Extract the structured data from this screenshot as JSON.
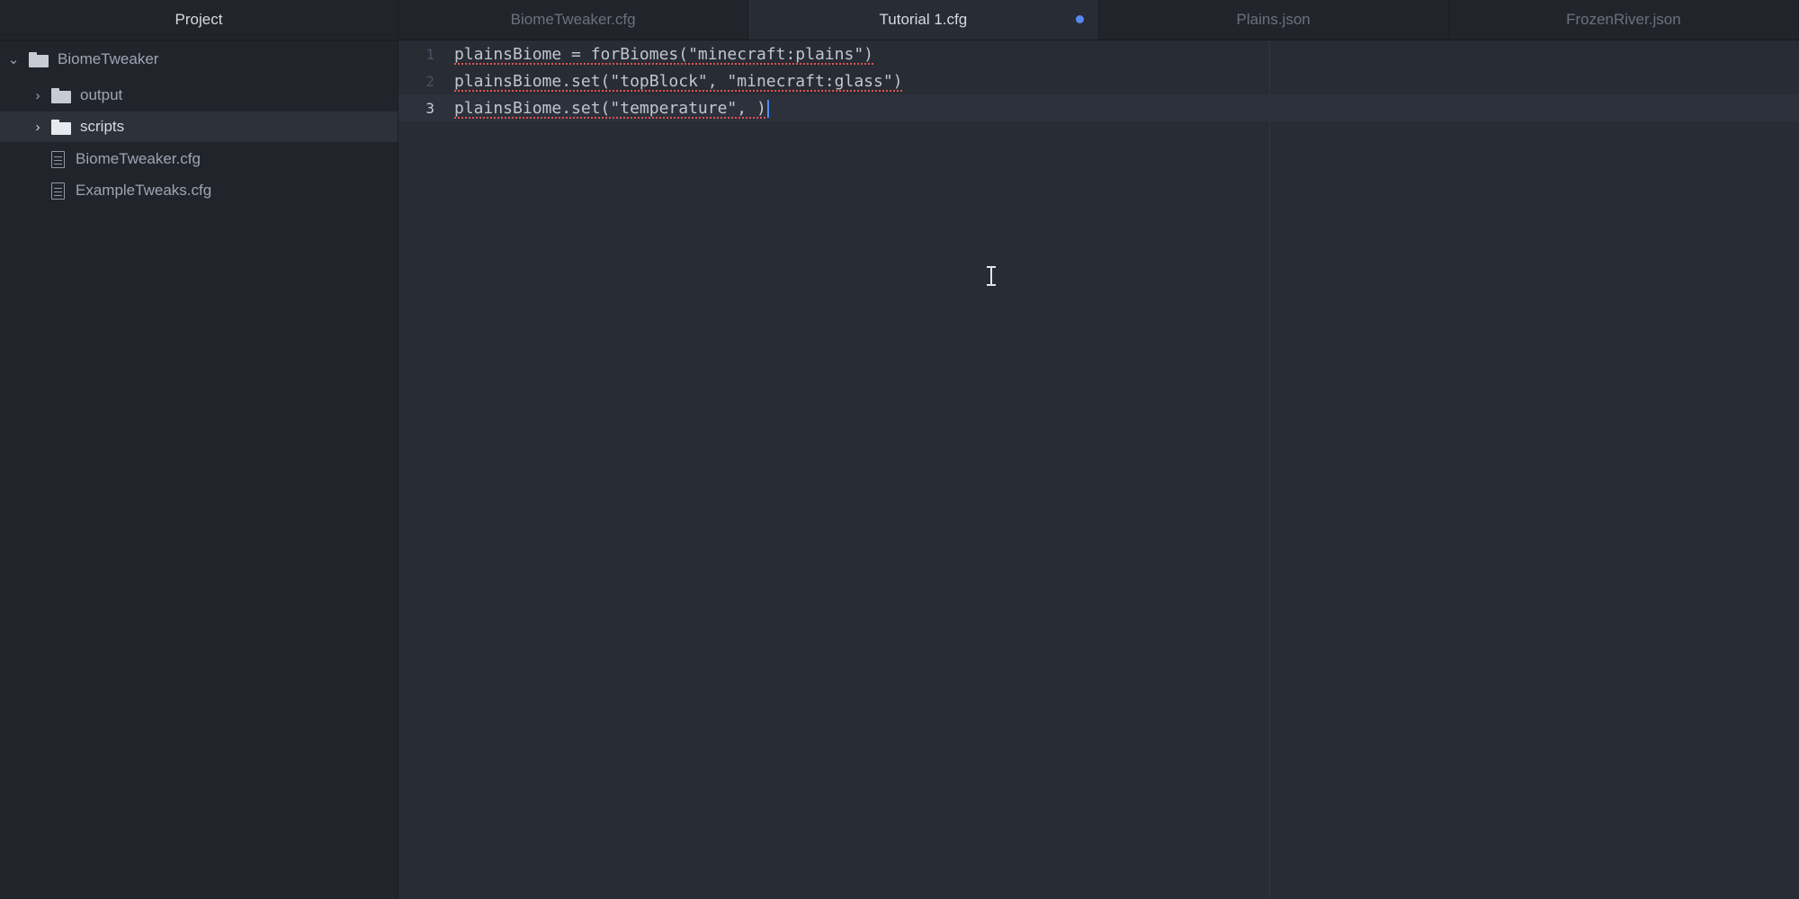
{
  "sidebar": {
    "header": "Project",
    "root": {
      "label": "BiomeTweaker",
      "expanded": true,
      "icon": "folder-icon"
    },
    "items": [
      {
        "label": "output",
        "type": "folder",
        "icon": "folder-icon",
        "expanded": false
      },
      {
        "label": "scripts",
        "type": "folder",
        "icon": "folder-icon",
        "expanded": false,
        "selected": true
      },
      {
        "label": "BiomeTweaker.cfg",
        "type": "file",
        "icon": "file-text-icon"
      },
      {
        "label": "ExampleTweaks.cfg",
        "type": "file",
        "icon": "file-text-icon"
      }
    ]
  },
  "tabs": [
    {
      "label": "BiomeTweaker.cfg",
      "active": false
    },
    {
      "label": "Tutorial 1.cfg",
      "active": true,
      "modified": true
    },
    {
      "label": "Plains.json",
      "active": false
    },
    {
      "label": "FrozenRiver.json",
      "active": false
    }
  ],
  "editor": {
    "current_line": 3,
    "lines": [
      {
        "number": "1",
        "text": "plainsBiome = forBiomes(\"minecraft:plains\")"
      },
      {
        "number": "2",
        "text": "plainsBiome.set(\"topBlock\", \"minecraft:glass\")"
      },
      {
        "number": "3",
        "text": "plainsBiome.set(\"temperature\", )"
      }
    ]
  },
  "colors": {
    "background": "#282c34",
    "sidebar": "#21252b",
    "accent_dot": "#568af2",
    "spellcheck_underline": "#e05252"
  }
}
